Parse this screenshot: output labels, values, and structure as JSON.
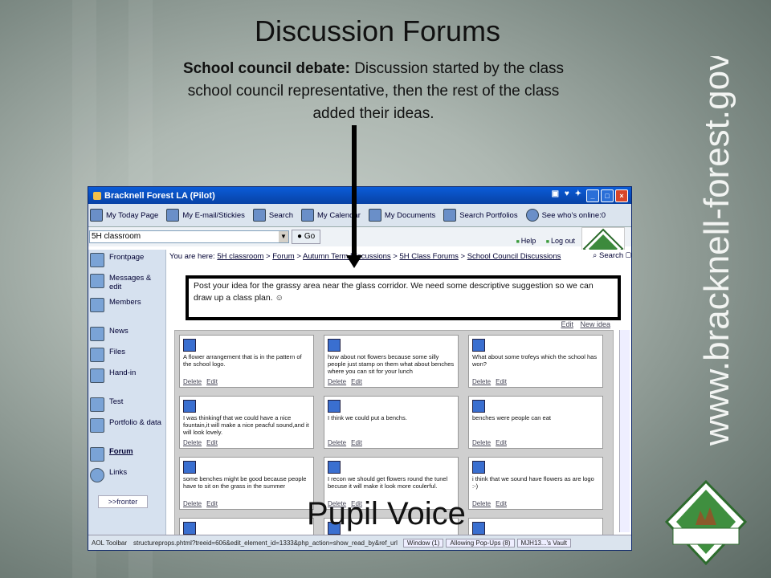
{
  "slide": {
    "title": "Discussion Forums",
    "desc_bold": "School council debate:",
    "desc_rest": "Discussion started by the class school council representative, then the rest of the class added their ideas.",
    "footer": "Pupil Voice",
    "vertical_url": "www.bracknell-forest.gov.uk"
  },
  "window": {
    "title": "Bracknell Forest LA (Pilot)",
    "toolbar": [
      "My Today Page",
      "My E-mail/Stickies",
      "Search",
      "My Calendar",
      "My Documents",
      "Search Portfolios",
      "See who's online:0"
    ],
    "address": "5H classroom",
    "go_label": "Go",
    "help_label": "Help",
    "logout_label": "Log out"
  },
  "sidebar": {
    "items": [
      "Frontpage",
      "Messages & edit",
      "Members",
      "News",
      "Files",
      "Hand-in",
      "Test",
      "Portfolio & data",
      "Forum",
      "Links"
    ],
    "fronter_label": ">>fronter"
  },
  "main": {
    "breadcrumb_prefix": "You are here:",
    "crumbs": [
      "5H classroom",
      "Forum",
      "Autumn Term Discussions",
      "5H Class Forums",
      "School Council Discussions"
    ],
    "search_label": "Search",
    "post_text": "Post your idea for the grassy area near the glass corridor.  We need some descriptive suggestion so we can draw up a class plan.",
    "edit_label": "Edit",
    "new_idea_label": "New idea",
    "delete_label": "Delete",
    "cards": [
      "A flower arrangement that is in the pattern of the school logo.",
      "how about not flowers because some silly people just stamp on them what about benches where you can sit for your lunch",
      "What about some trofeys which the school has won?",
      "I was thinkingf that we could have a nice fountain,it will make a nice peacful sound,and it will look lovely.",
      "I think we could put a benchs.",
      "benches were people can eat",
      "some benches might be good because people have to sit on the grass in the summer",
      "I recon we should get flowers round the tunel becuse it will make it look more coulerful.",
      "i think that we sound have flowers as are logo :-)"
    ]
  },
  "statusbar": {
    "toolbar_label": "AOL Toolbar",
    "url": "structureprops.phtml?treeid=606&edit_element_id=1333&php_action=show_read_by&ref_url",
    "window_label": "Window (1)",
    "popups_label": "Allowing Pop-Ups (8)",
    "vault_label": "MJH13...'s Vault"
  }
}
